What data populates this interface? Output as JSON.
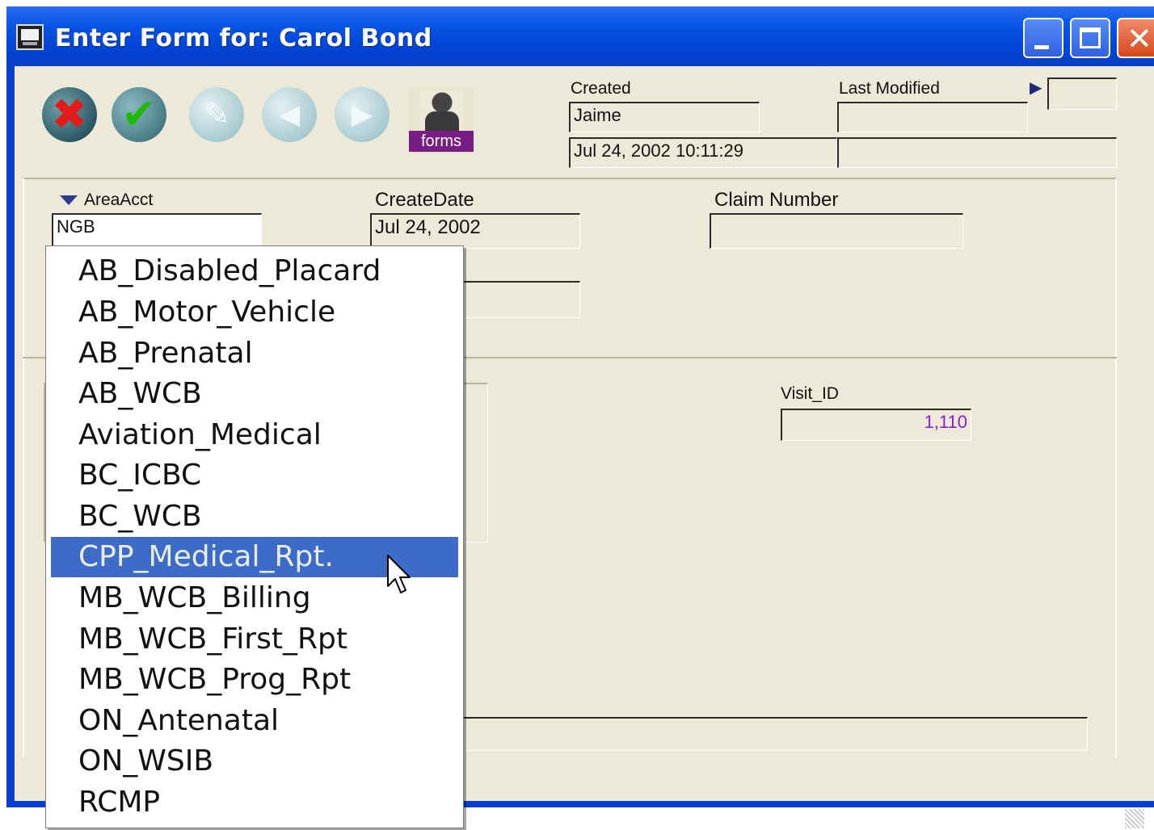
{
  "window": {
    "title": "Enter Form for: Carol Bond"
  },
  "toolbar": {
    "buttons": [
      {
        "name": "cancel",
        "icon": "x-icon"
      },
      {
        "name": "ok",
        "icon": "checkmark-icon"
      },
      {
        "name": "edit",
        "icon": "pencil-icon"
      },
      {
        "name": "previous",
        "icon": "left-arrow-icon"
      },
      {
        "name": "next",
        "icon": "right-arrow-icon"
      }
    ],
    "forms_label": "forms"
  },
  "audit": {
    "created_label": "Created",
    "created_by": "Jaime",
    "created_at": "Jul 24, 2002 10:11:29",
    "last_modified_label": "Last Modified",
    "last_modified_by": "",
    "last_modified_at": ""
  },
  "form": {
    "area_acct_label": "AreaAcct",
    "area_acct_value": "NGB",
    "create_date_label": "CreateDate",
    "create_date_value": "Jul 24, 2002",
    "claim_number_label": "Claim Number",
    "claim_number_value": "",
    "visit_id_label": "Visit_ID",
    "visit_id_value": "1,110"
  },
  "dropdown": {
    "items": [
      "AB_Disabled_Placard",
      "AB_Motor_Vehicle",
      "AB_Prenatal",
      "AB_WCB",
      "Aviation_Medical",
      "BC_ICBC",
      "BC_WCB",
      "CPP_Medical_Rpt.",
      "MB_WCB_Billing",
      "MB_WCB_First_Rpt",
      "MB_WCB_Prog_Rpt",
      "ON_Antenatal",
      "ON_WSIB",
      "RCMP"
    ],
    "selected": "CPP_Medical_Rpt."
  },
  "colors": {
    "titlebar": "#0a56e6",
    "selection": "#3c6bc8",
    "visit_id_text": "#8a1fd0",
    "forms_badge": "#7a1c86"
  }
}
